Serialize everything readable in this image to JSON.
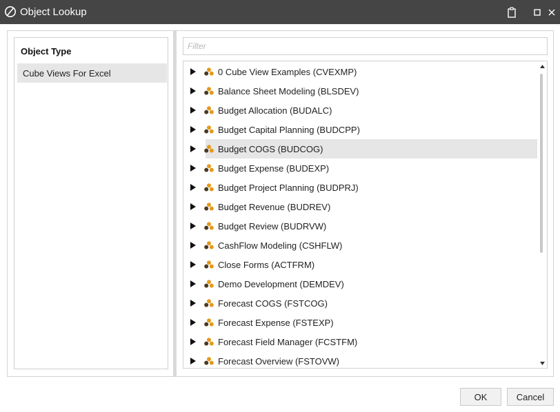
{
  "window": {
    "title": "Object Lookup",
    "logo_icon": "onestream-logo-icon",
    "controls": [
      "clipboard-icon",
      "maximize-icon",
      "close-icon"
    ]
  },
  "left_pane": {
    "header": "Object Type",
    "items": [
      {
        "label": "Cube Views For Excel",
        "selected": true
      }
    ]
  },
  "filter": {
    "placeholder": "Filter",
    "value": ""
  },
  "tree": {
    "node_icon": "cube-view-icon",
    "icon_colors": {
      "dark": "#4a3a20",
      "orange": "#e39a1c"
    },
    "items": [
      {
        "label": "0 Cube View Examples (CVEXMP)",
        "selected": false
      },
      {
        "label": "Balance Sheet Modeling (BLSDEV)",
        "selected": false
      },
      {
        "label": "Budget Allocation (BUDALC)",
        "selected": false
      },
      {
        "label": "Budget Capital Planning (BUDCPP)",
        "selected": false
      },
      {
        "label": "Budget COGS (BUDCOG)",
        "selected": true
      },
      {
        "label": "Budget Expense (BUDEXP)",
        "selected": false
      },
      {
        "label": "Budget Project Planning (BUDPRJ)",
        "selected": false
      },
      {
        "label": "Budget Revenue (BUDREV)",
        "selected": false
      },
      {
        "label": "Budget Review (BUDRVW)",
        "selected": false
      },
      {
        "label": "CashFlow Modeling (CSHFLW)",
        "selected": false
      },
      {
        "label": "Close Forms (ACTFRM)",
        "selected": false
      },
      {
        "label": "Demo Development (DEMDEV)",
        "selected": false
      },
      {
        "label": "Forecast COGS (FSTCOG)",
        "selected": false
      },
      {
        "label": "Forecast Expense (FSTEXP)",
        "selected": false
      },
      {
        "label": "Forecast Field Manager (FCSTFM)",
        "selected": false
      },
      {
        "label": "Forecast Overview (FSTOVW)",
        "selected": false
      }
    ]
  },
  "buttons": {
    "ok": "OK",
    "cancel": "Cancel"
  },
  "colors": {
    "titlebar": "#454545",
    "selection": "#e6e6e6"
  }
}
